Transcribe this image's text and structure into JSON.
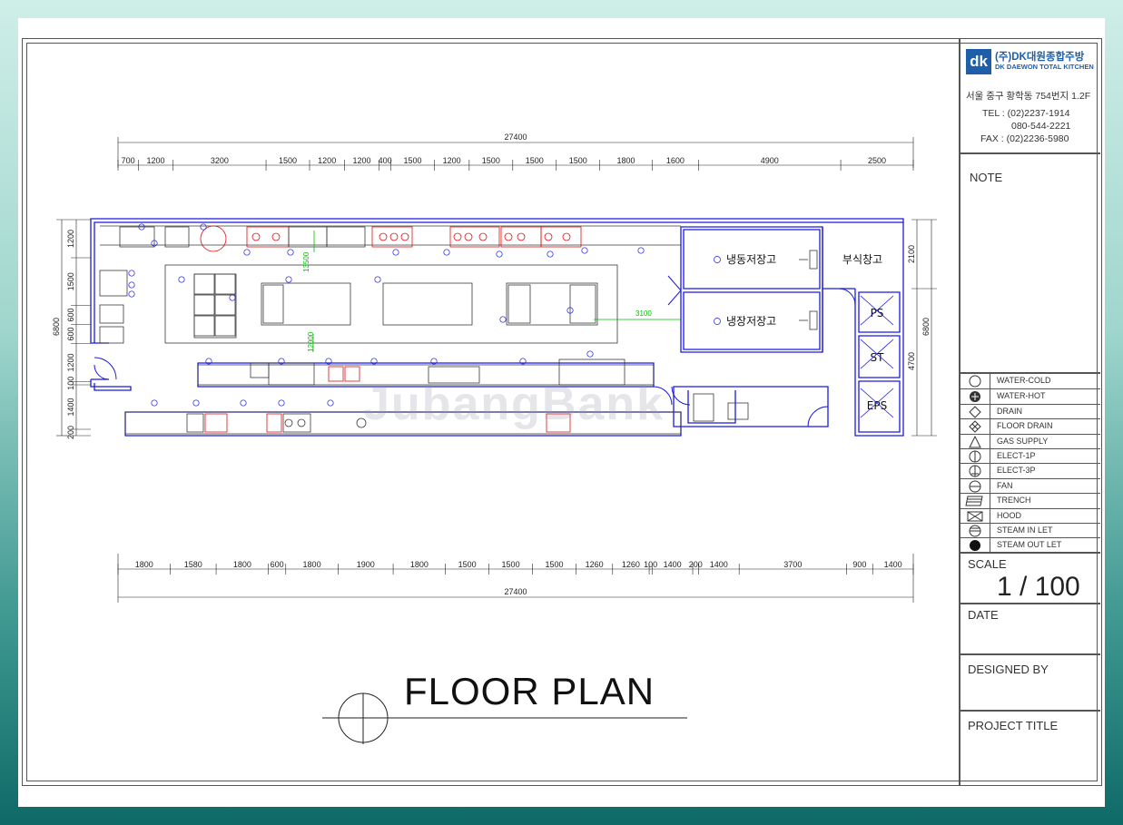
{
  "company": {
    "logo_mark": "dk",
    "logo_kr": "(주)DK대원종합주방",
    "logo_en": "DK DAEWON TOTAL KITCHEN",
    "address": "서울 중구 황학동 754번지 1.2F",
    "tel": "TEL : (02)2237-1914",
    "tel2": "080-544-2221",
    "fax": "FAX : (02)2236-5980"
  },
  "titleblock": {
    "note_label": "NOTE",
    "scale_label": "SCALE",
    "scale_value": "1 / 100",
    "date_label": "DATE",
    "designed_by_label": "DESIGNED BY",
    "project_title_label": "PROJECT TITLE"
  },
  "legend": [
    {
      "icon": "water-cold-icon",
      "label": "WATER-COLD"
    },
    {
      "icon": "water-hot-icon",
      "label": "WATER-HOT"
    },
    {
      "icon": "drain-icon",
      "label": "DRAIN"
    },
    {
      "icon": "floor-drain-icon",
      "label": "FLOOR DRAIN"
    },
    {
      "icon": "gas-supply-icon",
      "label": "GAS SUPPLY"
    },
    {
      "icon": "elect-1p-icon",
      "label": "ELECT-1P"
    },
    {
      "icon": "elect-3p-icon",
      "label": "ELECT-3P"
    },
    {
      "icon": "fan-icon",
      "label": "FAN"
    },
    {
      "icon": "trench-icon",
      "label": "TRENCH"
    },
    {
      "icon": "hood-icon",
      "label": "HOOD"
    },
    {
      "icon": "steam-inlet-icon",
      "label": "STEAM IN LET"
    },
    {
      "icon": "steam-outlet-icon",
      "label": "STEAM OUT LET"
    }
  ],
  "plan": {
    "title": "FLOOR PLAN",
    "watermark": "JubangBank",
    "overall_top": "27400",
    "overall_bottom": "27400",
    "top_dims": [
      "700",
      "1200",
      "3200",
      "1500",
      "1200",
      "1200",
      "400",
      "1500",
      "1200",
      "1500",
      "1500",
      "1500",
      "1800",
      "1600",
      "4900",
      "2500"
    ],
    "bottom_dims": [
      "1800",
      "1580",
      "1800",
      "600",
      "1800",
      "1900",
      "1800",
      "1500",
      "1500",
      "1500",
      "1260",
      "1260",
      "100",
      "1400",
      "200",
      "1400",
      "3700",
      "900",
      "1400"
    ],
    "left_dims": [
      "1200",
      "1500",
      "600",
      "600",
      "1200",
      "100",
      "1400",
      "200"
    ],
    "left_total": "6800",
    "right_dims": [
      "2100",
      "4700"
    ],
    "right_total": "6800",
    "inner_dim_1": "3100",
    "inner_dim_2": "13500",
    "inner_dim_3": "12000",
    "rooms": {
      "freezer": "냉동저장고",
      "cold_storage": "냉장저장고",
      "side_storage": "부식창고",
      "ps": "PS",
      "st": "ST",
      "eps": "EPS"
    }
  },
  "colors": {
    "wall": "#1a1ae0",
    "equipment": "#3a3a3a",
    "burner": "#e01010",
    "green": "#00c000"
  }
}
